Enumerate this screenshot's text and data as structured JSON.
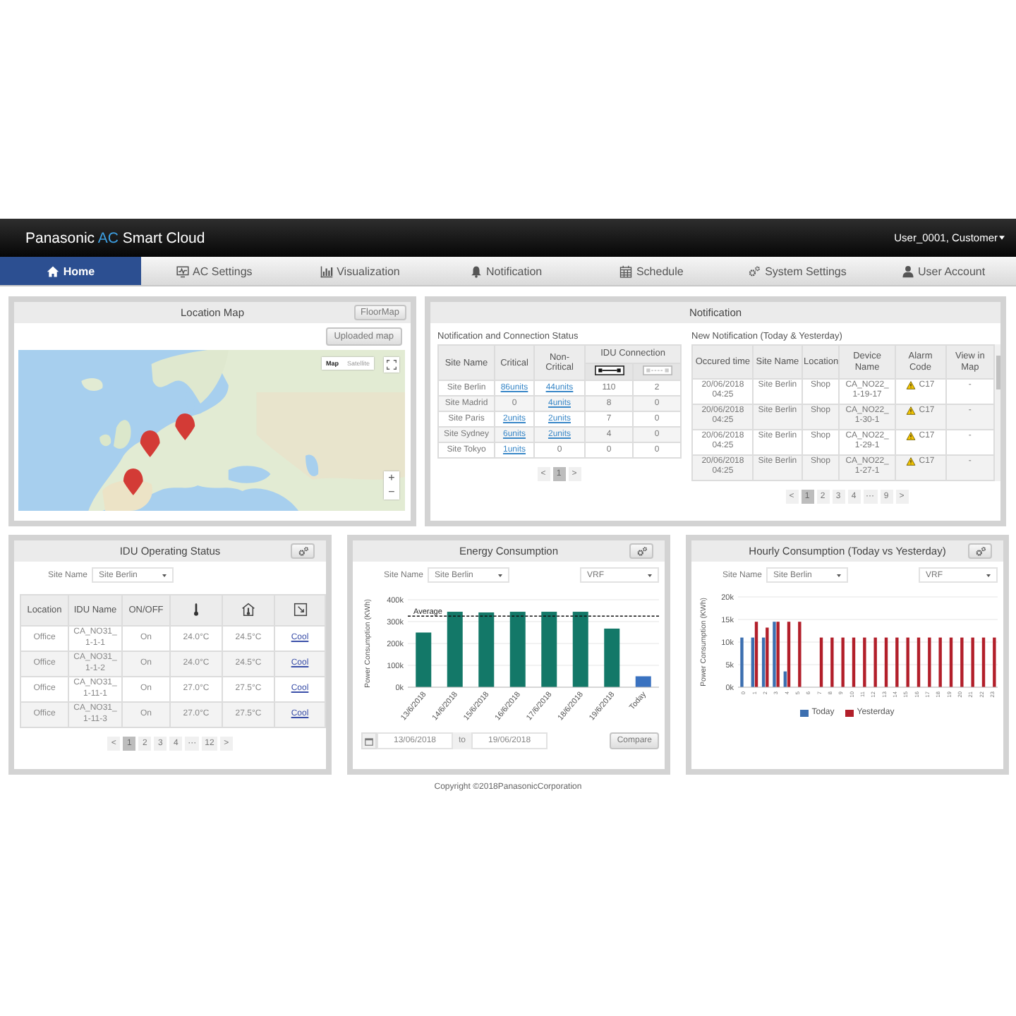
{
  "header": {
    "brand": {
      "maker": "Panasonic",
      "highlight": "AC",
      "product": "Smart Cloud"
    },
    "user_menu": "User_0001, Customer"
  },
  "nav": [
    {
      "label": "Home",
      "kind": "home",
      "selected": true
    },
    {
      "label": "AC Settings",
      "kind": "monitor",
      "selected": false
    },
    {
      "label": "Visualization",
      "kind": "chart",
      "selected": false
    },
    {
      "label": "Notification",
      "kind": "bell",
      "selected": false
    },
    {
      "label": "Schedule",
      "kind": "calendar",
      "selected": false
    },
    {
      "label": "System Settings",
      "kind": "gears",
      "selected": false
    },
    {
      "label": "User Account",
      "kind": "user",
      "selected": false
    }
  ],
  "location_map": {
    "title": "Location Map",
    "floor_button": "FloorMap",
    "upload_button": "Uploaded map",
    "map_types": [
      {
        "label": "Map",
        "selected": true
      },
      {
        "label": "Satellite",
        "selected": false
      }
    ],
    "zoom_in": "+",
    "zoom_out": "−"
  },
  "notification": {
    "title": "Notification",
    "status": {
      "title": "Notification and Connection Status",
      "site_header": "Site Name",
      "critical_header": "Critical",
      "non_critical_header": "Non-Critical",
      "connection_header": "IDU Connection",
      "rows": [
        {
          "site": "Site Berlin",
          "critical": {
            "text": "86units",
            "link": true
          },
          "non_critical": {
            "text": "44units",
            "link": true
          },
          "connected": "110",
          "disconnected": "2"
        },
        {
          "site": "Site Madrid",
          "critical": {
            "text": "0",
            "link": false
          },
          "non_critical": {
            "text": "4units",
            "link": true
          },
          "connected": "8",
          "disconnected": "0"
        },
        {
          "site": "Site Paris",
          "critical": {
            "text": "2units",
            "link": true
          },
          "non_critical": {
            "text": "2units",
            "link": true
          },
          "connected": "7",
          "disconnected": "0"
        },
        {
          "site": "Site Sydney",
          "critical": {
            "text": "6units",
            "link": true
          },
          "non_critical": {
            "text": "2units",
            "link": true
          },
          "connected": "4",
          "disconnected": "0"
        },
        {
          "site": "Site Tokyo",
          "critical": {
            "text": "1units",
            "link": true
          },
          "non_critical": {
            "text": "0",
            "link": false
          },
          "connected": "0",
          "disconnected": "0"
        }
      ],
      "pagination": {
        "prev": "<",
        "pages": [
          {
            "label": "1",
            "selected": true
          }
        ],
        "next": ">"
      }
    },
    "recent": {
      "title": "New Notification (Today & Yesterday)",
      "columns": [
        "Occured time",
        "Site Name",
        "Location",
        "Device Name",
        "Alarm Code",
        "View in Map"
      ],
      "rows": [
        {
          "time": "20/06/2018 04:25",
          "site": "Site Berlin",
          "location": "Shop",
          "device": "CA_NO22_ 1-19-17",
          "alarm": "C17",
          "view": "-"
        },
        {
          "time": "20/06/2018 04:25",
          "site": "Site Berlin",
          "location": "Shop",
          "device": "CA_NO22_ 1-30-1",
          "alarm": "C17",
          "view": "-"
        },
        {
          "time": "20/06/2018 04:25",
          "site": "Site Berlin",
          "location": "Shop",
          "device": "CA_NO22_ 1-29-1",
          "alarm": "C17",
          "view": "-"
        },
        {
          "time": "20/06/2018 04:25",
          "site": "Site Berlin",
          "location": "Shop",
          "device": "CA_NO22_ 1-27-1",
          "alarm": "C17",
          "view": "-"
        }
      ],
      "pagination": {
        "prev": "<",
        "pages": [
          {
            "label": "1",
            "selected": true
          },
          {
            "label": "2",
            "selected": false
          },
          {
            "label": "3",
            "selected": false
          },
          {
            "label": "4",
            "selected": false
          },
          {
            "label": "···",
            "selected": false
          },
          {
            "label": "9",
            "selected": false
          }
        ],
        "next": ">"
      }
    }
  },
  "idu_status": {
    "title": "IDU Operating Status",
    "site_label": "Site Name",
    "site": "Site Berlin",
    "columns": [
      {
        "label": "Location"
      },
      {
        "label": "IDU Name"
      },
      {
        "label": "ON/OFF"
      },
      {
        "kind": "thermometer"
      },
      {
        "kind": "roomtemp"
      },
      {
        "kind": "mode"
      }
    ],
    "rows": [
      {
        "location": "Office",
        "name": "CA_NO31_ 1-1-1",
        "power": "On",
        "set_temp": "24.0°C",
        "room_temp": "24.5°C",
        "mode": "Cool"
      },
      {
        "location": "Office",
        "name": "CA_NO31_ 1-1-2",
        "power": "On",
        "set_temp": "24.0°C",
        "room_temp": "24.5°C",
        "mode": "Cool"
      },
      {
        "location": "Office",
        "name": "CA_NO31_ 1-11-1",
        "power": "On",
        "set_temp": "27.0°C",
        "room_temp": "27.5°C",
        "mode": "Cool"
      },
      {
        "location": "Office",
        "name": "CA_NO31_ 1-11-3",
        "power": "On",
        "set_temp": "27.0°C",
        "room_temp": "27.5°C",
        "mode": "Cool"
      }
    ],
    "pagination": {
      "prev": "<",
      "pages": [
        {
          "label": "1",
          "selected": true
        },
        {
          "label": "2",
          "selected": false
        },
        {
          "label": "3",
          "selected": false
        },
        {
          "label": "4",
          "selected": false
        },
        {
          "label": "···",
          "selected": false
        },
        {
          "label": "12",
          "selected": false
        }
      ],
      "next": ">"
    }
  },
  "energy": {
    "title": "Energy Consumption",
    "site_label": "Site Name",
    "site": "Site Berlin",
    "system": "VRF",
    "chart_data": {
      "type": "bar",
      "ylabel": "Power Consumption (KWh)",
      "categories": [
        "13/6/2018",
        "14/6/2018",
        "15/6/2018",
        "16/6/2018",
        "17/6/2018",
        "18/6/2018",
        "19/6/2018",
        "Today"
      ],
      "values": [
        250000,
        345000,
        342000,
        345000,
        345000,
        345000,
        268000,
        50000
      ],
      "colors": [
        "#137868",
        "#137868",
        "#137868",
        "#137868",
        "#137868",
        "#137868",
        "#137868",
        "#3a72c0"
      ],
      "ylim": [
        0,
        400000
      ],
      "yticks": [
        {
          "value": 0,
          "label": "0k"
        },
        {
          "value": 100000,
          "label": "100k"
        },
        {
          "value": 200000,
          "label": "200k"
        },
        {
          "value": 300000,
          "label": "300k"
        },
        {
          "value": 400000,
          "label": "400k"
        }
      ],
      "grid": true,
      "ref_lines": [
        {
          "axis": "y",
          "value": 325000,
          "label": "Average"
        }
      ]
    },
    "date_from": "13/06/2018",
    "date_to_label": "to",
    "date_to": "19/06/2018",
    "compare": "Compare"
  },
  "hourly": {
    "title": "Hourly Consumption (Today vs Yesterday)",
    "site_label": "Site Name",
    "site": "Site Berlin",
    "system": "VRF",
    "chart_data": {
      "type": "bar",
      "ylabel": "Power Consumption (KWh)",
      "categories": [
        "0",
        "1",
        "2",
        "3",
        "4",
        "5",
        "6",
        "7",
        "8",
        "9",
        "10",
        "11",
        "12",
        "13",
        "14",
        "15",
        "16",
        "17",
        "18",
        "19",
        "20",
        "21",
        "22",
        "23"
      ],
      "series": [
        {
          "name": "Today",
          "color": "#3c6fb0",
          "values": [
            11000,
            11000,
            11000,
            14500,
            3500,
            null,
            null,
            null,
            null,
            null,
            null,
            null,
            null,
            null,
            null,
            null,
            null,
            null,
            null,
            null,
            null,
            null,
            null,
            null
          ]
        },
        {
          "name": "Yesterday",
          "color": "#b21f2a",
          "values": [
            null,
            14500,
            13200,
            14500,
            14500,
            14500,
            null,
            11000,
            11000,
            11000,
            11000,
            11000,
            11000,
            11000,
            11000,
            11000,
            11000,
            11000,
            11000,
            11000,
            11000,
            11000,
            11000,
            11000
          ]
        }
      ],
      "ylim": [
        0,
        20000
      ],
      "grid": true,
      "legend": "bottom",
      "yticks": [
        {
          "value": 0,
          "label": "0k"
        },
        {
          "value": 5000,
          "label": "5k"
        },
        {
          "value": 10000,
          "label": "10k"
        },
        {
          "value": 15000,
          "label": "15k"
        },
        {
          "value": 20000,
          "label": "20k"
        }
      ]
    }
  },
  "copyright": "Copyright ©2018PanasonicCorporation"
}
